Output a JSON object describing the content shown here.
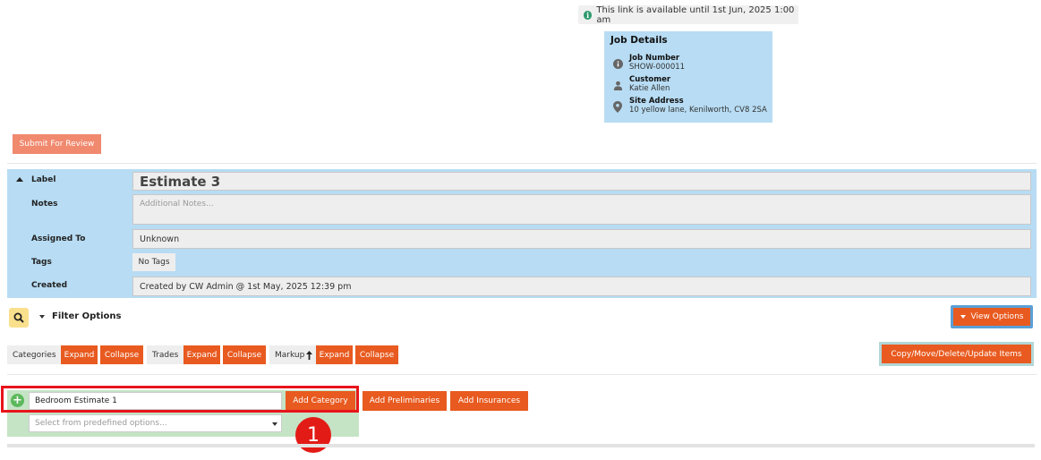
{
  "notice": {
    "icon": "info-icon",
    "text": "This link is available until 1st Jun, 2025 1:00 am"
  },
  "job_details": {
    "title": "Job Details",
    "rows": [
      {
        "icon": "info-icon",
        "label": "Job Number",
        "value": "SHOW-000011"
      },
      {
        "icon": "person-icon",
        "label": "Customer",
        "value": "Katie Allen"
      },
      {
        "icon": "map-pin-icon",
        "label": "Site Address",
        "value": "10 yellow lane, Kenilworth, CV8 2SA"
      }
    ]
  },
  "submit_label": "Submit For Review",
  "estimate": {
    "label_label": "Label",
    "label_value": "Estimate 3",
    "notes_label": "Notes",
    "notes_placeholder": "Additional Notes...",
    "assigned_label": "Assigned To",
    "assigned_value": "Unknown",
    "tags_label": "Tags",
    "tags_value": "No Tags",
    "created_label": "Created",
    "created_value": "Created by CW Admin @ 1st May, 2025 12:39 pm"
  },
  "filter": {
    "label": "Filter Options",
    "view_options": "View Options"
  },
  "groups": {
    "categories": "Categories",
    "trades": "Trades",
    "markup": "Markup",
    "expand": "Expand",
    "collapse": "Collapse",
    "copy_move": "Copy/Move/Delete/Update Items"
  },
  "add_category": {
    "input_value": "Bedroom Estimate 1",
    "button": "Add Category",
    "select_placeholder": "Select from predefined options...",
    "preliminaries": "Add Preliminaries",
    "insurances": "Add Insurances"
  },
  "annotation_badge": "1",
  "colors": {
    "accent": "#e85a1f",
    "panel": "#b7dcf3",
    "highlight": "#e8141b"
  }
}
